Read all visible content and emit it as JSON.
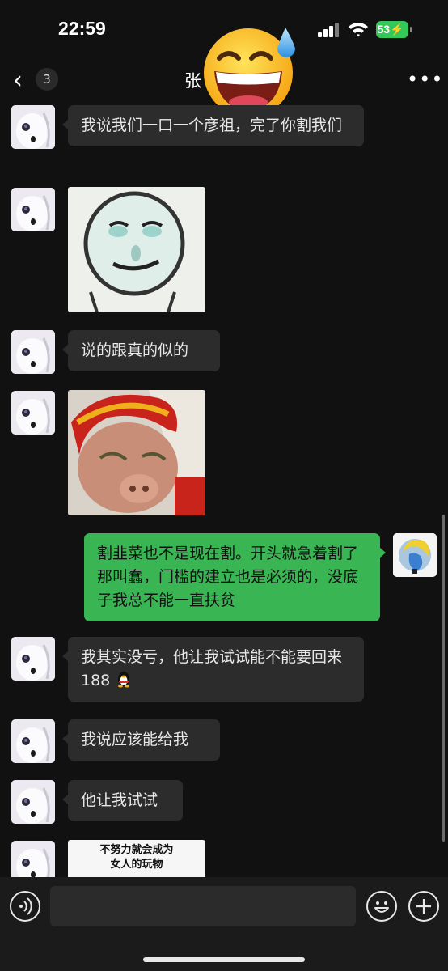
{
  "status": {
    "time": "22:59",
    "battery": "53"
  },
  "nav": {
    "back_glyph": "‹",
    "unread_count": "3",
    "title": "张",
    "more_glyph": "•••"
  },
  "messages": [
    {
      "side": "left",
      "type": "text",
      "text": "我说我们一口一个彦祖，完了你割我们"
    },
    {
      "side": "left",
      "type": "sticker",
      "name": "face-sketch-sticker"
    },
    {
      "side": "left",
      "type": "text",
      "text": "说的跟真的似的"
    },
    {
      "side": "left",
      "type": "sticker",
      "name": "pig-doll-sticker"
    },
    {
      "side": "right",
      "type": "text",
      "text": "割韭菜也不是现在割。开头就急着割了那叫蠢，门槛的建立也是必须的，没底子我总不能一直扶贫"
    },
    {
      "side": "left",
      "type": "text",
      "text": "我其实没亏，他让我试试能不能要回来 188"
    },
    {
      "side": "left",
      "type": "text",
      "text": "我说应该能给我"
    },
    {
      "side": "left",
      "type": "text",
      "text": "他让我试试"
    },
    {
      "side": "left",
      "type": "sticker",
      "name": "text-sticker",
      "caption_line1": "不努力就会成为",
      "caption_line2": "女人的玩物"
    }
  ],
  "icons": {
    "voice": "voice-icon",
    "emoji": "emoji-icon",
    "add": "plus-icon",
    "overlay": "sweat-smile-emoji"
  }
}
